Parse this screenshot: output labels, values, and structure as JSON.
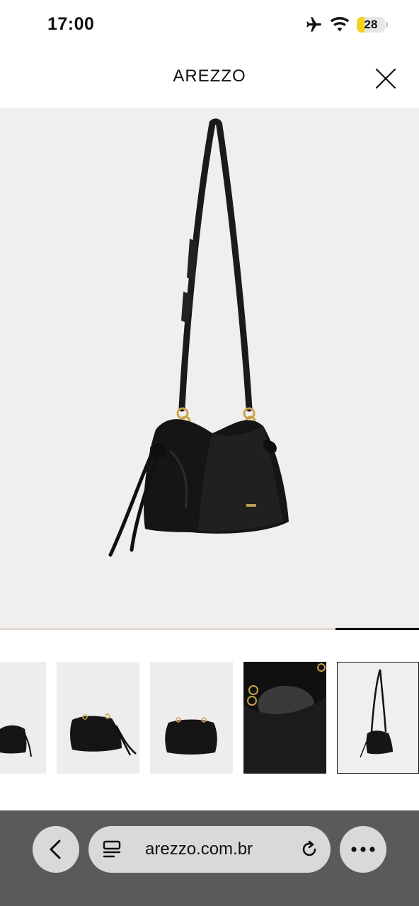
{
  "status_bar": {
    "time": "17:00",
    "battery_level": "28",
    "icons": [
      "airplane-icon",
      "wifi-icon",
      "battery-icon"
    ],
    "battery_color": "#f5d31a"
  },
  "header": {
    "title": "AREZZO",
    "close_icon": "close-icon"
  },
  "gallery": {
    "main_image_subject": "black leather shoulder bag with long strap",
    "progress": 0.8,
    "thumbnail_count": 5,
    "selected_thumbnail": 5,
    "thumbnails": [
      "bag-side-view",
      "bag-front-three-quarter",
      "bag-front",
      "bag-interior-close-up",
      "bag-with-strap"
    ]
  },
  "browser": {
    "url": "arezzo.com.br",
    "back_icon": "chevron-left-icon",
    "reader_icon": "reader-mode-icon",
    "reload_icon": "reload-icon",
    "more_icon": "more-icon",
    "bar_color": "#5a5a5a"
  },
  "colors": {
    "background": "#ffffff",
    "image_background": "#efefef",
    "progress_track": "#e3d9d2",
    "progress_fill": "#111111"
  }
}
